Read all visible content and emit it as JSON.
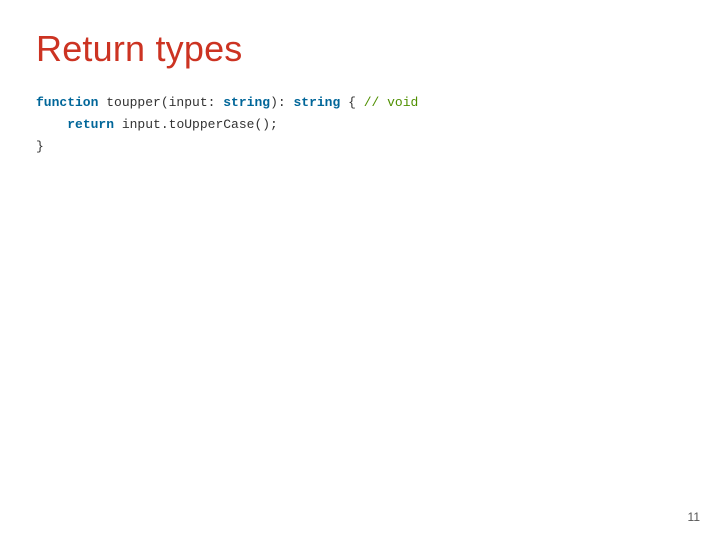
{
  "title": "Return types",
  "code": {
    "kw_function": "function",
    "fn_name_open": " toupper(input: ",
    "type_param": "string",
    "mid": "): ",
    "type_return": "string",
    "open_brace": " { ",
    "comment": "// void",
    "indent": "    ",
    "kw_return": "return",
    "body_rest": " input.toUpperCase();",
    "close_brace": "}"
  },
  "page_number": "11"
}
